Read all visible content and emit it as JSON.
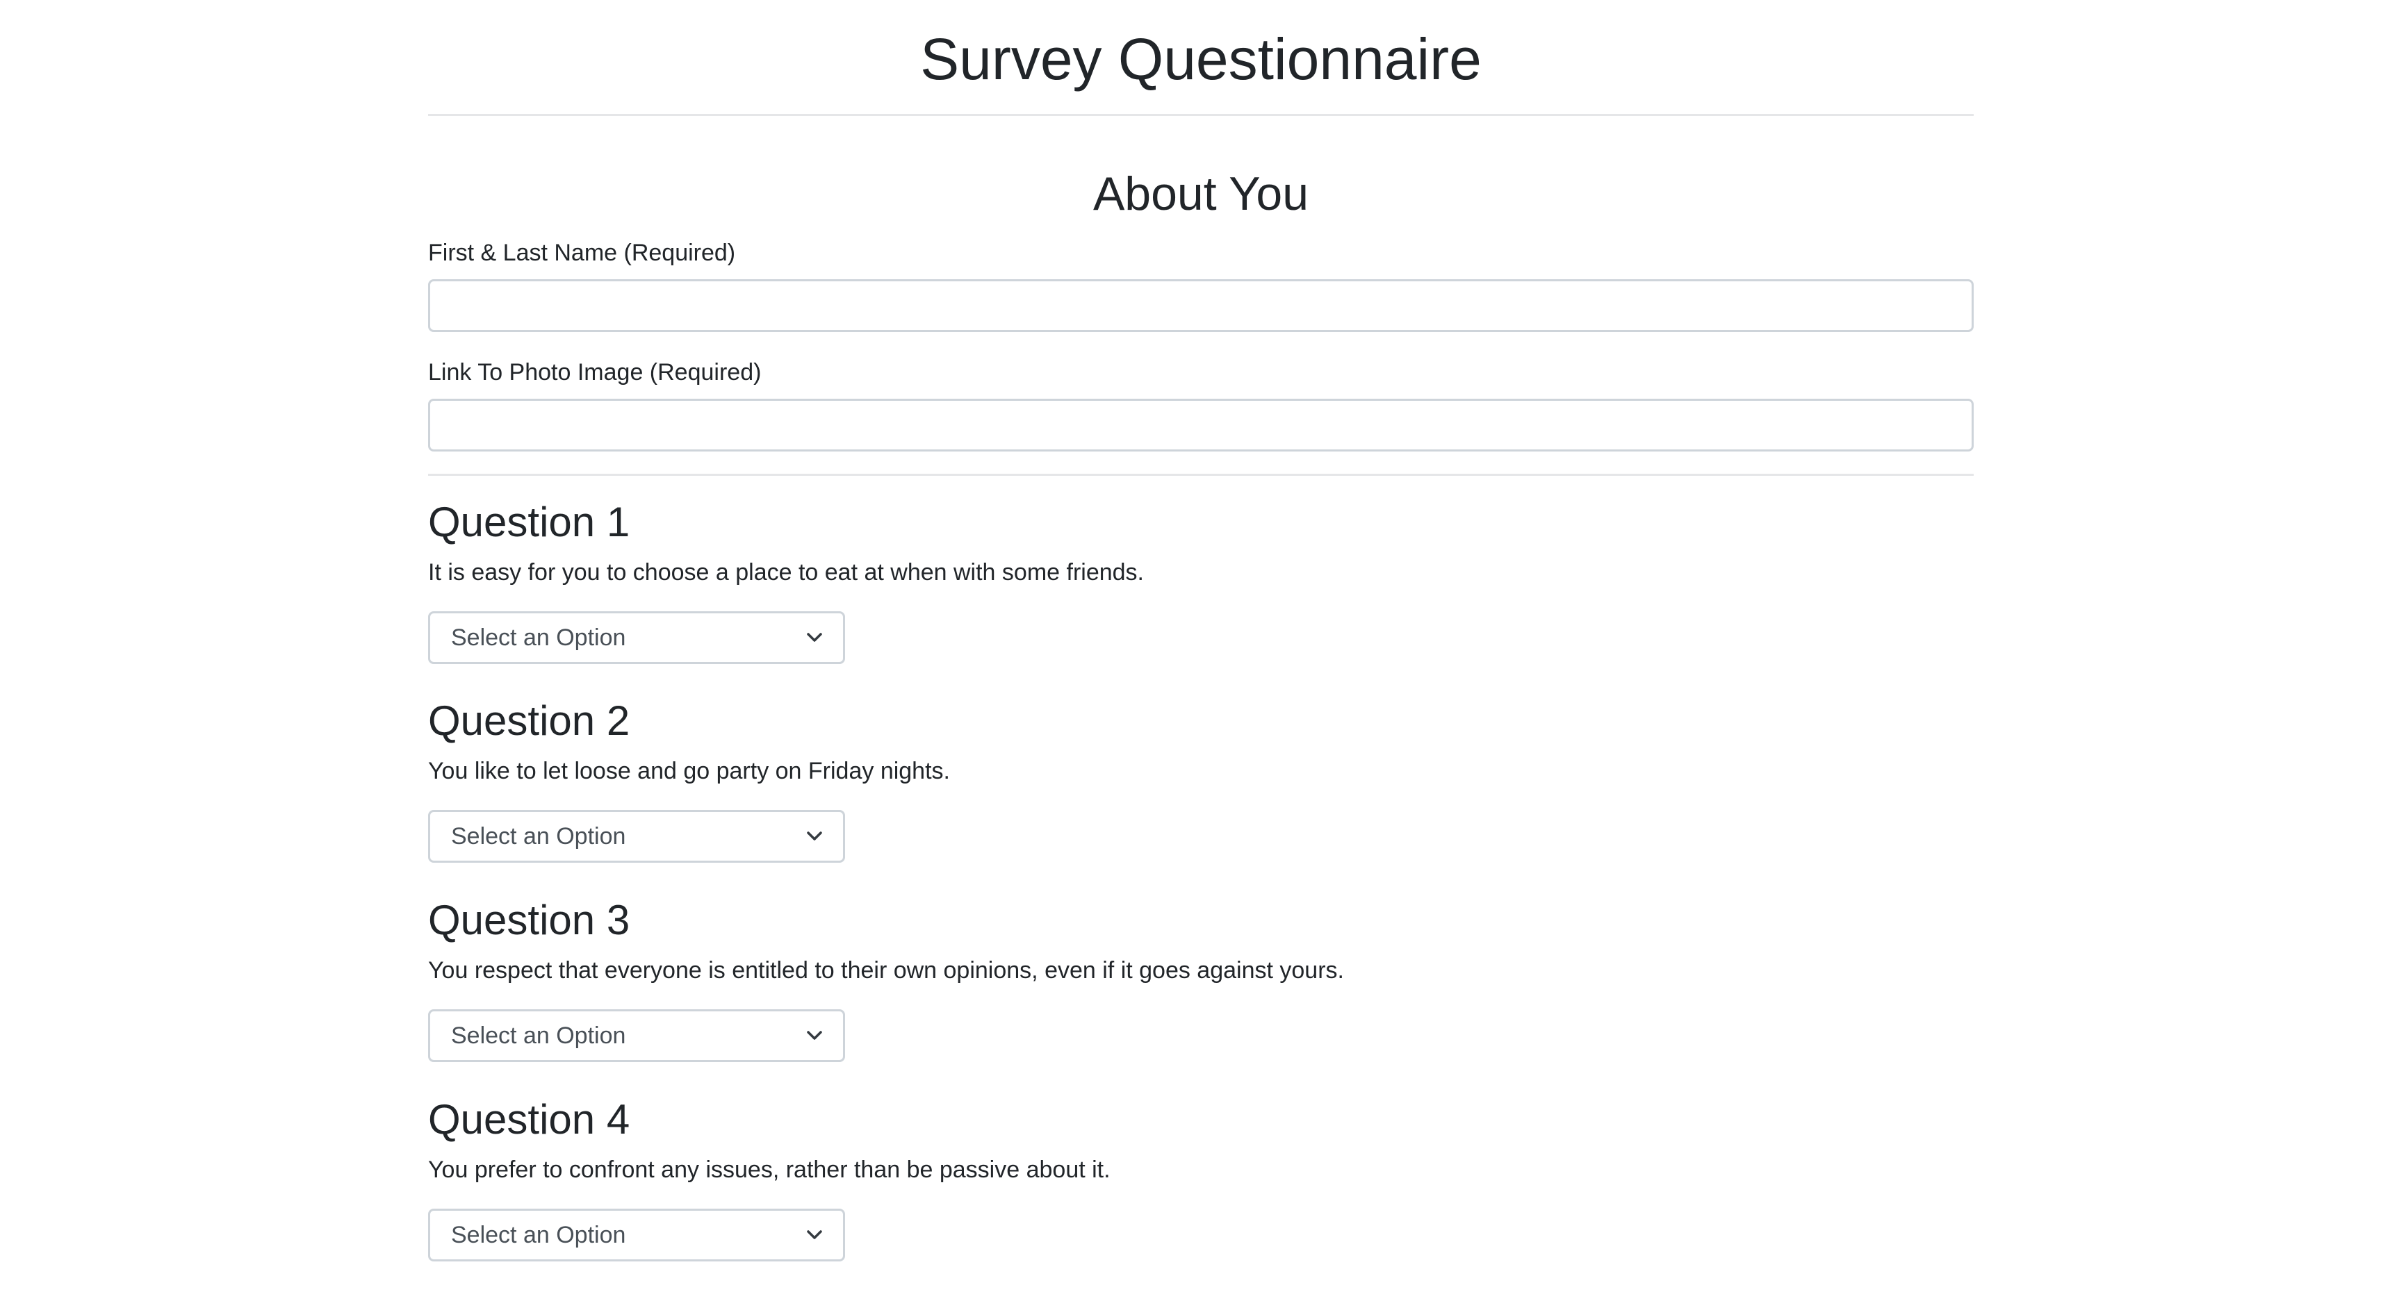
{
  "header": {
    "title": "Survey Questionnaire"
  },
  "about": {
    "title": "About You",
    "name_label": "First & Last Name (Required)",
    "name_value": "",
    "photo_label": "Link To Photo Image (Required)",
    "photo_value": ""
  },
  "questions": [
    {
      "title": "Question 1",
      "text": "It is easy for you to choose a place to eat at when with some friends.",
      "selected": "Select an Option"
    },
    {
      "title": "Question 2",
      "text": "You like to let loose and go party on Friday nights.",
      "selected": "Select an Option"
    },
    {
      "title": "Question 3",
      "text": "You respect that everyone is entitled to their own opinions, even if it goes against yours.",
      "selected": "Select an Option"
    },
    {
      "title": "Question 4",
      "text": "You prefer to confront any issues, rather than be passive about it.",
      "selected": "Select an Option"
    }
  ],
  "icons": {
    "select_arrow": "chevron-down-icon"
  },
  "colors": {
    "text": "#212529",
    "border": "#ced4da",
    "divider": "#e5e6e8",
    "muted_text": "#495057"
  }
}
